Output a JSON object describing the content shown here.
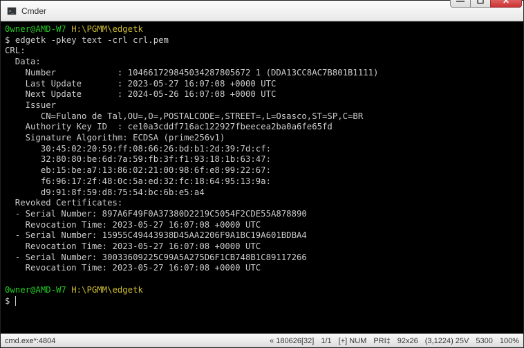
{
  "titlebar": {
    "title": "Cmder"
  },
  "prompt": {
    "user": "0wner@AMD-W7",
    "path": "H:\\PGMM\\edgetk",
    "symbol": "$"
  },
  "command": "edgetk -pkey text -crl crl.pem",
  "output": {
    "l0": "CRL:",
    "l1": "  Data:",
    "l2": "    Number            : 104661729845034287805672 1 (DDA13CC8AC7B801B1111)",
    "l3": "    Last Update       : 2023-05-27 16:07:08 +0000 UTC",
    "l4": "    Next Update       : 2024-05-26 16:07:08 +0000 UTC",
    "l5": "    Issuer",
    "l6": "       CN=Fulano de Tal,OU=,O=,POSTALCODE=,STREET=,L=Osasco,ST=SP,C=BR",
    "l7": "    Authority Key ID  : ce10a3cddf716ac122927fbeecea2ba0a6fe65fd",
    "l8": "    Signature Algorithm: ECDSA (prime256v1)",
    "l9": "       30:45:02:20:59:ff:08:66:26:bd:b1:2d:39:7d:cf:",
    "l10": "       32:80:80:be:6d:7a:59:fb:3f:f1:93:18:1b:63:47:",
    "l11": "       eb:15:be:a7:13:86:02:21:00:98:6f:e8:99:22:67:",
    "l12": "       f6:96:17:2f:48:0c:5a:ed:32:fc:18:64:95:13:9a:",
    "l13": "       d9:91:8f:59:d8:75:54:bc:6b:e5:a4",
    "l14": "  Revoked Certificates:",
    "l15": "  - Serial Number: 897A6F49F0A37380D2219C5054F2CDE55A878890",
    "l16": "    Revocation Time: 2023-05-27 16:07:08 +0000 UTC",
    "l17": "  - Serial Number: 15955C49443938D45AA2206F9A1BC19A601BDBA4",
    "l18": "    Revocation Time: 2023-05-27 16:07:08 +0000 UTC",
    "l19": "  - Serial Number: 30033609225C99A5A275D6F1CB748B1C89117266",
    "l20": "    Revocation Time: 2023-05-27 16:07:08 +0000 UTC"
  },
  "status": {
    "left": "cmd.exe*:4804",
    "s1": "« 180626[32]",
    "s2": "1/1",
    "s3": "[+] NUM",
    "s4": "PRI‡",
    "s5": "92x26",
    "s6": "(3,1224) 25V",
    "s7": "5300",
    "s8": "100%"
  }
}
